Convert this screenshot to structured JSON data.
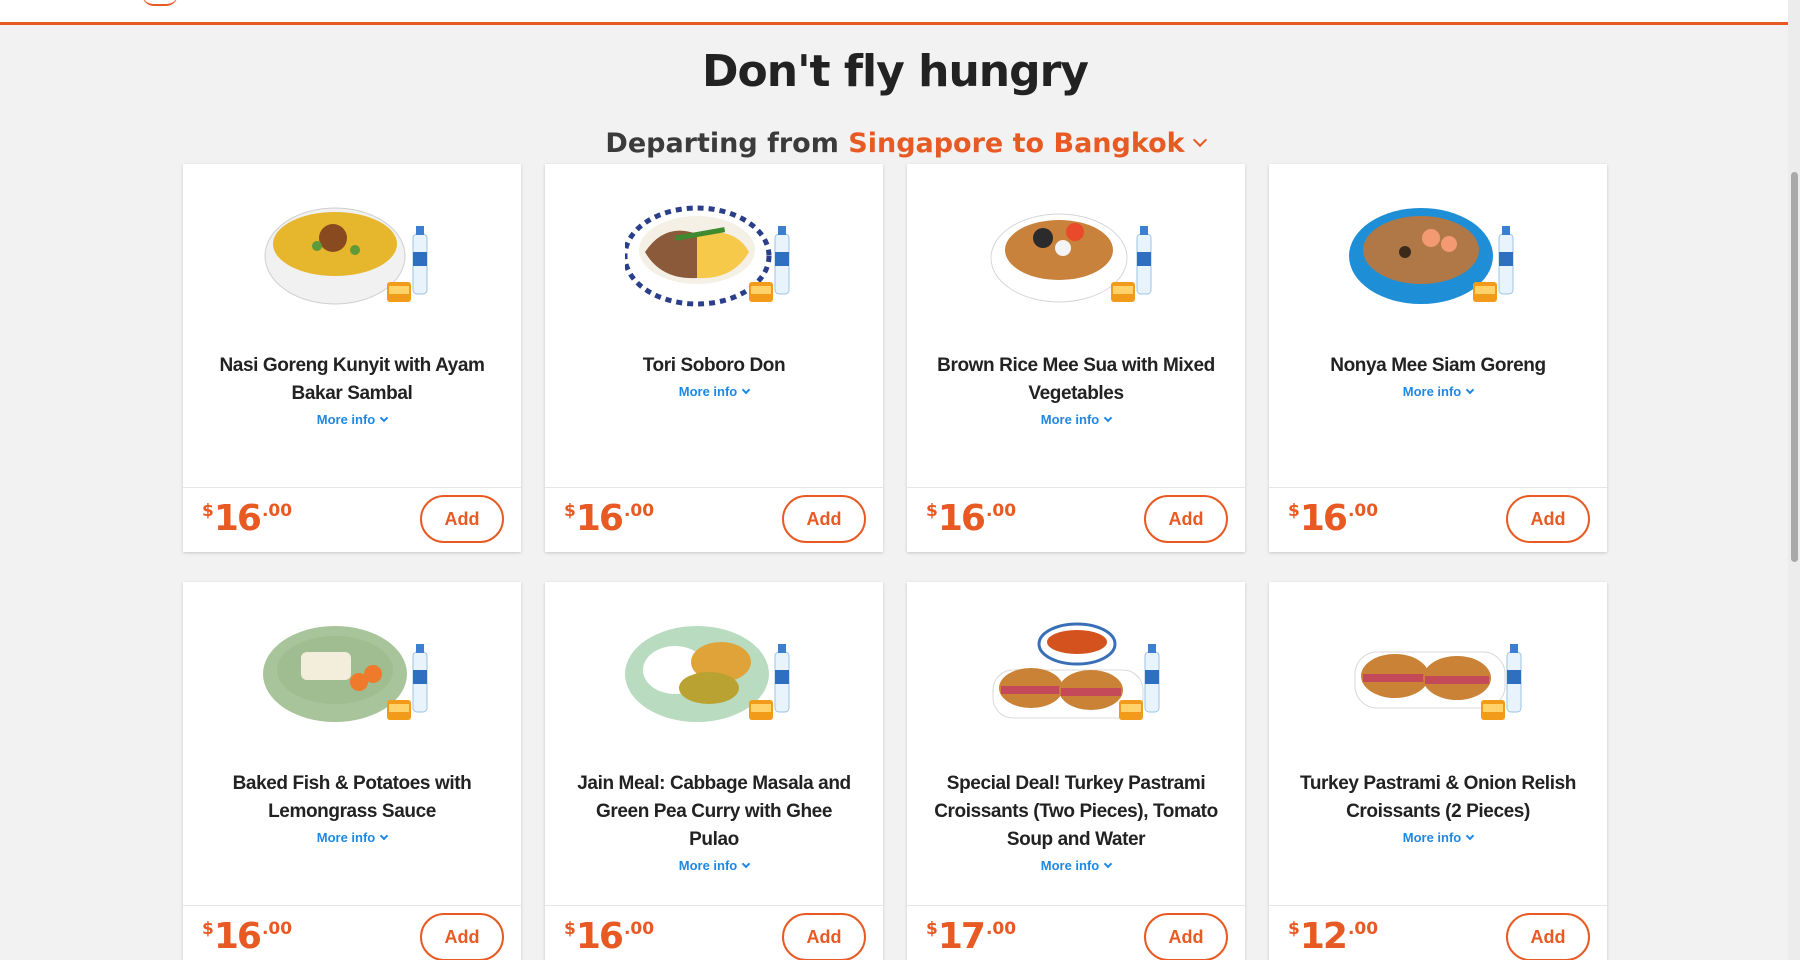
{
  "header": {
    "title": "Don't fly hungry",
    "departing_label": "Departing from",
    "route": "Singapore to Bangkok"
  },
  "colors": {
    "accent": "#e85a23",
    "link": "#1e88e5",
    "background": "#f2f2f2"
  },
  "meals": [
    {
      "name": "Nasi Goreng Kunyit with Ayam Bakar Sambal",
      "more_info": "More info",
      "currency": "$",
      "price_main": "16",
      "price_cents": ".00",
      "add_label": "Add",
      "image": "fried-rice-bowl"
    },
    {
      "name": "Tori Soboro Don",
      "more_info": "More info",
      "currency": "$",
      "price_main": "16",
      "price_cents": ".00",
      "add_label": "Add",
      "image": "soboro-don-bowl"
    },
    {
      "name": "Brown Rice Mee Sua with Mixed Vegetables",
      "more_info": "More info",
      "currency": "$",
      "price_main": "16",
      "price_cents": ".00",
      "add_label": "Add",
      "image": "mee-sua-bowl"
    },
    {
      "name": "Nonya Mee Siam Goreng",
      "more_info": "More info",
      "currency": "$",
      "price_main": "16",
      "price_cents": ".00",
      "add_label": "Add",
      "image": "mee-siam-bowl"
    },
    {
      "name": "Baked Fish & Potatoes with Lemongrass Sauce",
      "more_info": "More info",
      "currency": "$",
      "price_main": "16",
      "price_cents": ".00",
      "add_label": "Add",
      "image": "baked-fish-plate"
    },
    {
      "name": "Jain Meal: Cabbage Masala and Green Pea Curry with Ghee Pulao",
      "more_info": "More info",
      "currency": "$",
      "price_main": "16",
      "price_cents": ".00",
      "add_label": "Add",
      "image": "jain-meal-plate"
    },
    {
      "name": "Special Deal! Turkey Pastrami Croissants (Two Pieces), Tomato Soup and Water",
      "more_info": "More info",
      "currency": "$",
      "price_main": "17",
      "price_cents": ".00",
      "add_label": "Add",
      "image": "croissant-soup-plate"
    },
    {
      "name": "Turkey Pastrami & Onion Relish Croissants (2 Pieces)",
      "more_info": "More info",
      "currency": "$",
      "price_main": "12",
      "price_cents": ".00",
      "add_label": "Add",
      "image": "croissant-plate"
    }
  ]
}
